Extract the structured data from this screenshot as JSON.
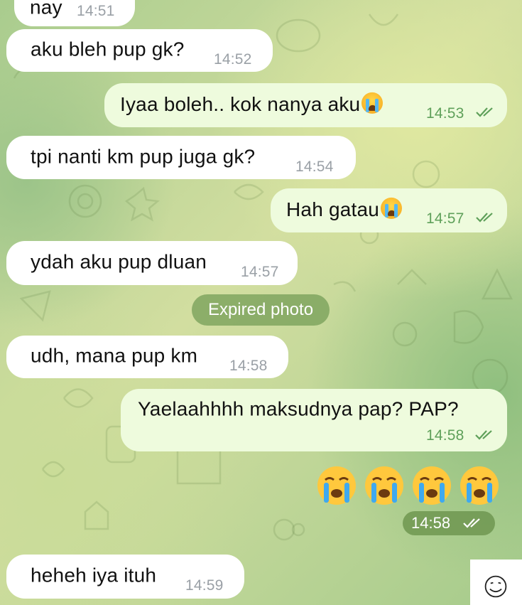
{
  "chat": {
    "messages": [
      {
        "text": "nay",
        "time": "14:51",
        "direction": "incoming"
      },
      {
        "text": "aku bleh pup gk?",
        "time": "14:52",
        "direction": "incoming"
      },
      {
        "text": "Iyaa boleh.. kok nanya aku",
        "emoji": "crying-face",
        "time": "14:53",
        "direction": "outgoing",
        "status": "read"
      },
      {
        "text": "tpi nanti km pup juga gk?",
        "time": "14:54",
        "direction": "incoming"
      },
      {
        "text": "Hah gatau",
        "emoji": "crying-face",
        "time": "14:57",
        "direction": "outgoing",
        "status": "read"
      },
      {
        "text": "ydah aku pup dluan",
        "time": "14:57",
        "direction": "incoming"
      },
      {
        "service": "Expired photo"
      },
      {
        "text": "udh, mana pup km",
        "time": "14:58",
        "direction": "incoming"
      },
      {
        "text": "Yaelaahhhh maksudnya pap? PAP?",
        "time": "14:58",
        "direction": "outgoing",
        "status": "read"
      },
      {
        "emoji_only": [
          "crying-face",
          "crying-face",
          "crying-face",
          "crying-face"
        ],
        "time": "14:58",
        "direction": "outgoing",
        "status": "read"
      },
      {
        "text": "heheh iya ituh",
        "time": "14:59",
        "direction": "incoming"
      }
    ]
  },
  "colors": {
    "incoming_bubble": "#ffffff",
    "outgoing_bubble": "#eefbdd",
    "outgoing_time": "#5fa05a",
    "incoming_time": "#9aa0a6",
    "service_pill": "#78a05a"
  },
  "icons": {
    "read_status": "double-check-icon",
    "emoji": "loudly-crying-face-emoji",
    "corner": "smiley-face-icon"
  }
}
